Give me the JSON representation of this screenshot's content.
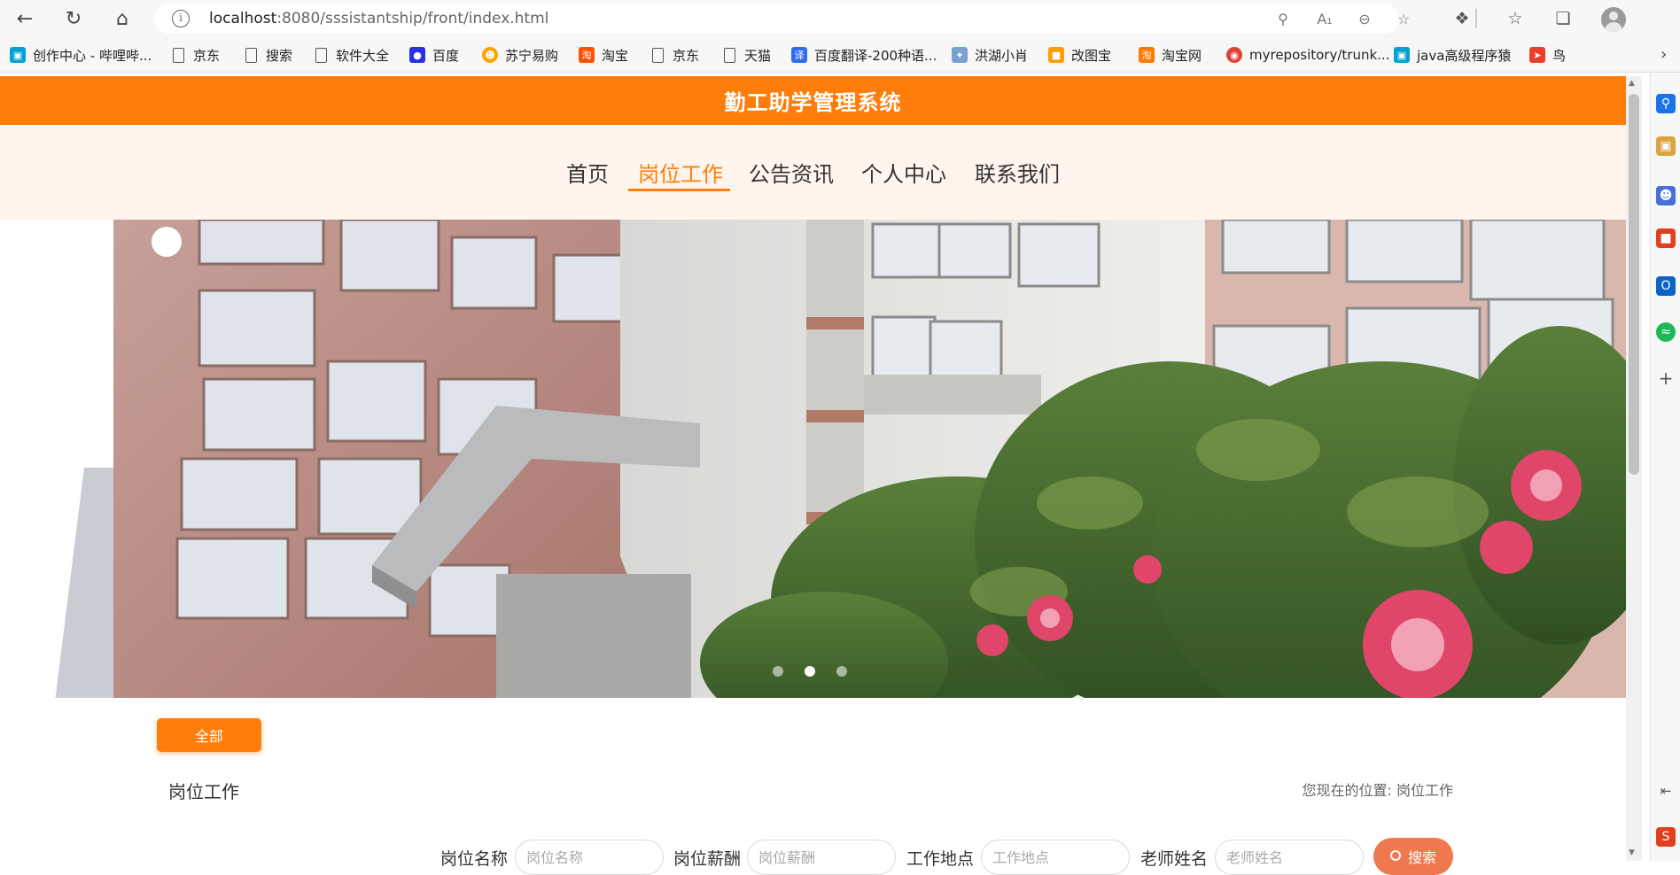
{
  "browser": {
    "url_host": "localhost",
    "url_rest": ":8080/sssistantship/front/index.html",
    "bookmarks": [
      {
        "label": "创作中心 - 哔哩哔...",
        "icon": "bilibili-icon",
        "color": "#00a1d6"
      },
      {
        "label": "京东",
        "icon": "page-icon"
      },
      {
        "label": "搜索",
        "icon": "page-icon"
      },
      {
        "label": "软件大全",
        "icon": "page-icon"
      },
      {
        "label": "百度",
        "icon": "baidu-paw-icon",
        "color": "#2932e1"
      },
      {
        "label": "苏宁易购",
        "icon": "suning-icon",
        "color": "#f7a600"
      },
      {
        "label": "淘宝",
        "icon": "taobao-icon",
        "color": "#ff5000"
      },
      {
        "label": "京东",
        "icon": "page-icon"
      },
      {
        "label": "天猫",
        "icon": "page-icon"
      },
      {
        "label": "百度翻译-200种语...",
        "icon": "translate-icon",
        "color": "#2f6cf6"
      },
      {
        "label": "洪湖小肖",
        "icon": "bird-icon",
        "color": "#7aa0d0"
      },
      {
        "label": "改图宝",
        "icon": "gaitubao-icon",
        "color": "#ff9f00"
      },
      {
        "label": "淘宝网",
        "icon": "taobao-icon",
        "color": "#ff7a00"
      },
      {
        "label": "myrepository/trunk...",
        "icon": "chrome-icon",
        "color": "#db4437"
      },
      {
        "label": "java高级程序猿",
        "icon": "bilibili-icon",
        "color": "#00a1d6"
      },
      {
        "label": "鸟",
        "icon": "bird-red-icon",
        "color": "#e9402a"
      }
    ]
  },
  "site": {
    "title": "勤工助学管理系统",
    "nav": [
      {
        "label": "首页",
        "active": false
      },
      {
        "label": "岗位工作",
        "active": true
      },
      {
        "label": "公告资讯",
        "active": false
      },
      {
        "label": "个人中心",
        "active": false
      },
      {
        "label": "联系我们",
        "active": false
      }
    ],
    "banner": {
      "active_slide": 1,
      "slides": 3
    },
    "filter_all": "全部",
    "section_title": "岗位工作",
    "breadcrumb_prefix": "您现在的位置:",
    "breadcrumb_current": "岗位工作",
    "search": {
      "fields": [
        {
          "label": "岗位名称",
          "placeholder": "岗位名称"
        },
        {
          "label": "岗位薪酬",
          "placeholder": "岗位薪酬"
        },
        {
          "label": "工作地点",
          "placeholder": "工作地点"
        },
        {
          "label": "老师姓名",
          "placeholder": "老师姓名"
        }
      ],
      "button": "搜索"
    }
  },
  "colors": {
    "accent": "#ff7d0a",
    "nav_bg": "#fff5ec",
    "search_button": "#f0784e"
  }
}
